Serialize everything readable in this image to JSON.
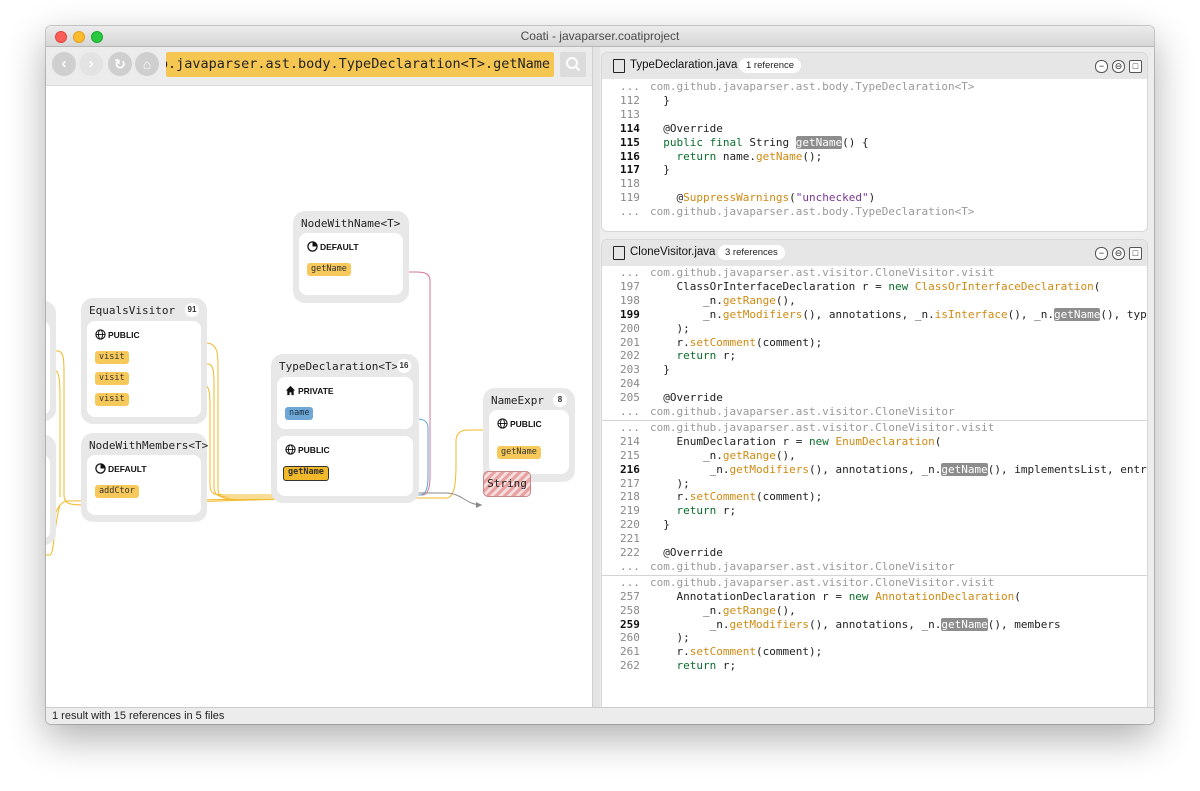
{
  "window": {
    "title": "Coati - javaparser.coatiproject"
  },
  "toolbar": {
    "back_label": "‹",
    "forward_label": "›",
    "refresh_label": "↻",
    "home_label": "⌂",
    "search_value": "com.github.javaparser.ast.body.TypeDeclaration<T>.getName",
    "search_icon": "search-icon"
  },
  "graph": {
    "nodes": {
      "node_with_name": {
        "title": "NodeWithName<T>",
        "section": "DEFAULT",
        "members": [
          "getName"
        ]
      },
      "equals_visitor": {
        "title": "EqualsVisitor",
        "count": "91",
        "section": "PUBLIC",
        "members": [
          "visit",
          "visit",
          "visit"
        ]
      },
      "node_with_members": {
        "title": "NodeWithMembers<T>",
        "section": "DEFAULT",
        "members": [
          "addCtor"
        ]
      },
      "type_declaration": {
        "title": "TypeDeclaration<T>",
        "count": "16",
        "private_section": "PRIVATE",
        "private_members": [
          "name"
        ],
        "public_section": "PUBLIC",
        "public_members": [
          "getName"
        ]
      },
      "name_expr": {
        "title": "NameExpr",
        "count": "8",
        "section": "PUBLIC",
        "members": [
          "getName"
        ]
      },
      "string": {
        "title": "String"
      }
    },
    "colors": {
      "call_edge": "#f2b92a",
      "override_edge": "#d4779b",
      "usage_edge": "#5ba3d0",
      "type_edge": "#888888"
    }
  },
  "code": {
    "files": [
      {
        "name": "TypeDeclaration.java",
        "refs": "1 reference",
        "lines": [
          {
            "n": "...",
            "t": "com.github.javaparser.ast.body.TypeDeclaration<T>"
          },
          {
            "n": "112",
            "t": "  }"
          },
          {
            "n": "113",
            "t": ""
          },
          {
            "n": "114",
            "t": "  @Override"
          },
          {
            "n": "115",
            "t": "  public final String getName() {"
          },
          {
            "n": "116",
            "t": "    return name.getName();"
          },
          {
            "n": "117",
            "t": "  }"
          },
          {
            "n": "118",
            "t": ""
          },
          {
            "n": "119",
            "t": "    @SuppressWarnings(\"unchecked\")"
          },
          {
            "n": "...",
            "t": "com.github.javaparser.ast.body.TypeDeclaration<T>"
          }
        ]
      },
      {
        "name": "CloneVisitor.java",
        "refs": "3 references",
        "snippet1": [
          {
            "n": "...",
            "t": "com.github.javaparser.ast.visitor.CloneVisitor.visit"
          },
          {
            "n": "197",
            "t": "    ClassOrInterfaceDeclaration r = new ClassOrInterfaceDeclaration("
          },
          {
            "n": "198",
            "t": "        _n.getRange(),"
          },
          {
            "n": "199",
            "t": "        _n.getModifiers(), annotations, _n.isInterface(), _n.getName(), typePa"
          },
          {
            "n": "200",
            "t": "    );"
          },
          {
            "n": "201",
            "t": "    r.setComment(comment);"
          },
          {
            "n": "202",
            "t": "    return r;"
          },
          {
            "n": "203",
            "t": "  }"
          },
          {
            "n": "204",
            "t": ""
          },
          {
            "n": "205",
            "t": "  @Override"
          },
          {
            "n": "...",
            "t": "com.github.javaparser.ast.visitor.CloneVisitor"
          }
        ],
        "snippet2": [
          {
            "n": "...",
            "t": "com.github.javaparser.ast.visitor.CloneVisitor.visit"
          },
          {
            "n": "214",
            "t": "    EnumDeclaration r = new EnumDeclaration("
          },
          {
            "n": "215",
            "t": "        _n.getRange(),"
          },
          {
            "n": "216",
            "t": "         _n.getModifiers(), annotations, _n.getName(), implementsList, entries"
          },
          {
            "n": "217",
            "t": "    );"
          },
          {
            "n": "218",
            "t": "    r.setComment(comment);"
          },
          {
            "n": "219",
            "t": "    return r;"
          },
          {
            "n": "220",
            "t": "  }"
          },
          {
            "n": "221",
            "t": ""
          },
          {
            "n": "222",
            "t": "  @Override"
          },
          {
            "n": "...",
            "t": "com.github.javaparser.ast.visitor.CloneVisitor"
          }
        ],
        "snippet3": [
          {
            "n": "...",
            "t": "com.github.javaparser.ast.visitor.CloneVisitor.visit"
          },
          {
            "n": "257",
            "t": "    AnnotationDeclaration r = new AnnotationDeclaration("
          },
          {
            "n": "258",
            "t": "        _n.getRange(),"
          },
          {
            "n": "259",
            "t": "         _n.getModifiers(), annotations, _n.getName(), members"
          },
          {
            "n": "260",
            "t": "    );"
          },
          {
            "n": "261",
            "t": "    r.setComment(comment);"
          },
          {
            "n": "262",
            "t": "    return r;"
          }
        ]
      }
    ],
    "highlighted_lines": [
      "114",
      "115",
      "116",
      "117",
      "199",
      "216",
      "259"
    ],
    "keywords": [
      "public",
      "final",
      "return",
      "new"
    ],
    "functions": [
      "getName",
      "setComment",
      "getRange",
      "getModifiers",
      "isInterface",
      "ClassOrInterfaceDeclaration",
      "EnumDeclaration",
      "AnnotationDeclaration",
      "SuppressWarnings"
    ],
    "strings": [
      "\"unchecked\""
    ],
    "highlight_word": "getName",
    "ctrl_minimize": "−",
    "ctrl_restore": "⊖",
    "ctrl_maximize": "□"
  },
  "status": {
    "text": "1 result with 15 references in 5 files"
  }
}
